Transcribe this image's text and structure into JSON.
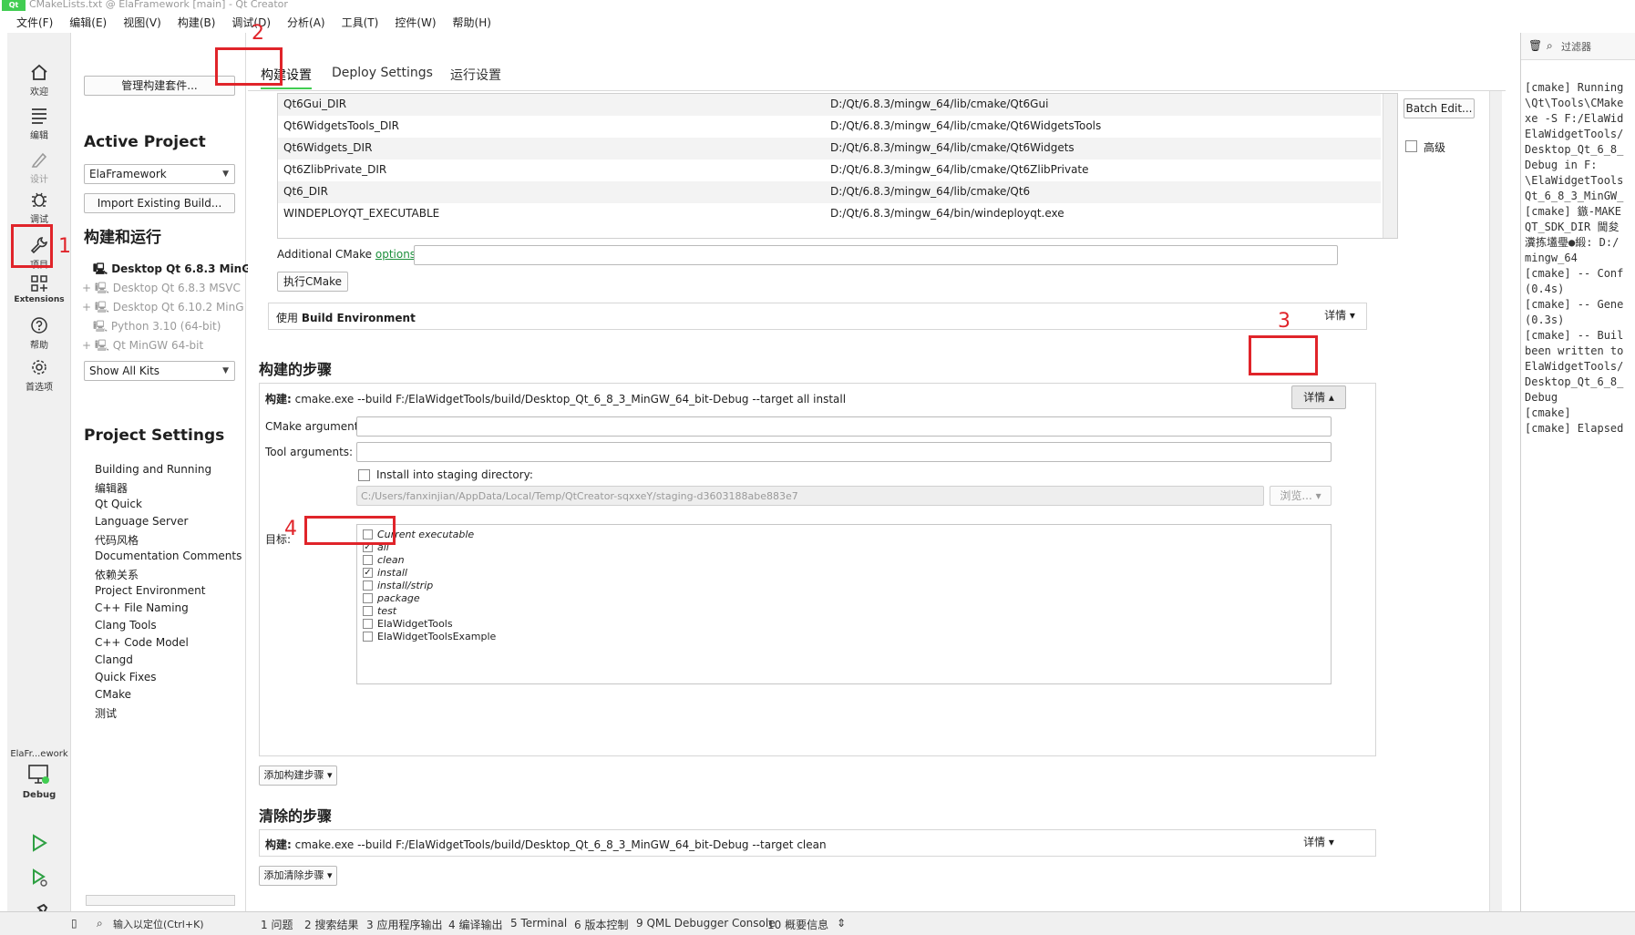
{
  "window": {
    "app_badge": "Qt",
    "title": "CMakeLists.txt @ ElaFramework [main] - Qt Creator"
  },
  "menu": [
    "文件(F)",
    "编辑(E)",
    "视图(V)",
    "构建(B)",
    "调试(D)",
    "分析(A)",
    "工具(T)",
    "控件(W)",
    "帮助(H)"
  ],
  "modebar": {
    "welcome": "欢迎",
    "edit": "编辑",
    "design": "设计",
    "debug": "调试",
    "projects": "项目",
    "extensions": "Extensions",
    "help": "帮助",
    "preferences": "首选项",
    "target_project": "ElaFr...ework",
    "target_config": "Debug"
  },
  "left": {
    "manage_kits": "管理构建套件...",
    "active_project_title": "Active Project",
    "active_project": "ElaFramework",
    "import_build": "Import Existing Build...",
    "build_run_title": "构建和运行",
    "kits": [
      "Desktop Qt 6.8.3 MinG",
      "Desktop Qt 6.8.3 MSVC",
      "Desktop Qt 6.10.2 MinG",
      "Python 3.10 (64-bit)",
      "Qt  MinGW 64-bit"
    ],
    "show_kits": "Show All Kits",
    "project_settings_title": "Project Settings",
    "settings": [
      "Building and Running",
      "编辑器",
      "Qt Quick",
      "Language Server",
      "代码风格",
      "Documentation Comments",
      "依赖关系",
      "Project Environment",
      "C++ File Naming",
      "Clang Tools",
      "C++ Code Model",
      "Clangd",
      "Quick Fixes",
      "CMake",
      "测试"
    ]
  },
  "tabs": [
    "构建设置",
    "Deploy Settings",
    "运行设置"
  ],
  "cmake_table": [
    {
      "key": "Qt6Gui_DIR",
      "value": "D:/Qt/6.8.3/mingw_64/lib/cmake/Qt6Gui"
    },
    {
      "key": "Qt6WidgetsTools_DIR",
      "value": "D:/Qt/6.8.3/mingw_64/lib/cmake/Qt6WidgetsTools"
    },
    {
      "key": "Qt6Widgets_DIR",
      "value": "D:/Qt/6.8.3/mingw_64/lib/cmake/Qt6Widgets"
    },
    {
      "key": "Qt6ZlibPrivate_DIR",
      "value": "D:/Qt/6.8.3/mingw_64/lib/cmake/Qt6ZlibPrivate"
    },
    {
      "key": "Qt6_DIR",
      "value": "D:/Qt/6.8.3/mingw_64/lib/cmake/Qt6"
    },
    {
      "key": "WINDEPLOYQT_EXECUTABLE",
      "value": "D:/Qt/6.8.3/mingw_64/bin/windeployqt.exe"
    }
  ],
  "batch_edit": "Batch Edit...",
  "advanced": "高级",
  "additional_cmake_label": "Additional CMake ",
  "additional_cmake_link": "options",
  "additional_cmake_colon": ":",
  "run_cmake": "执行CMake",
  "build_env_prefix": "使用",
  "build_env": "Build Environment",
  "details": "详情",
  "build_steps_title": "构建的步骤",
  "build_step_prefix": "构建:",
  "build_step_cmd": "cmake.exe --build F:/ElaWidgetTools/build/Desktop_Qt_6_8_3_MinGW_64_bit-Debug --target all install",
  "cmake_args_label": "CMake arguments:",
  "tool_args_label": "Tool arguments:",
  "staging_label": "Install into staging directory:",
  "staging_path": "C:/Users/fanxinjian/AppData/Local/Temp/QtCreator-sqxxeY/staging-d3603188abe883e7",
  "browse": "浏览...",
  "targets_label": "目标:",
  "targets": [
    {
      "name": "Current executable",
      "checked": false,
      "italic": true
    },
    {
      "name": "all",
      "checked": true,
      "italic": true
    },
    {
      "name": "clean",
      "checked": false,
      "italic": true
    },
    {
      "name": "install",
      "checked": true,
      "italic": true
    },
    {
      "name": "install/strip",
      "checked": false,
      "italic": true
    },
    {
      "name": "package",
      "checked": false,
      "italic": true
    },
    {
      "name": "test",
      "checked": false,
      "italic": true
    },
    {
      "name": "ElaWidgetTools",
      "checked": false,
      "italic": false
    },
    {
      "name": "ElaWidgetToolsExample",
      "checked": false,
      "italic": false
    }
  ],
  "add_build_step": "添加构建步骤",
  "clean_steps_title": "清除的步骤",
  "clean_step_cmd": "cmake.exe --build F:/ElaWidgetTools/build/Desktop_Qt_6_8_3_MinGW_64_bit-Debug --target clean",
  "add_clean_step": "添加清除步骤",
  "annotations": [
    "1",
    "2",
    "3",
    "4"
  ],
  "right": {
    "filter": "过滤器",
    "log": "[cmake] Running\n\\Qt\\Tools\\CMake\nxe -S F:/ElaWid\nElaWidgetTools/\nDesktop_Qt_6_8_\nDebug in F:\n\\ElaWidgetTools\nQt_6_8_3_MinGW_\n[cmake] 鏃-MAKE\nQT_SDK_DIR 閫夋\n瀵拣壒璺●緞: D:/\nmingw_64\n[cmake] -- Conf\n(0.4s)\n[cmake] -- Gene\n(0.3s)\n[cmake] -- Buil\nbeen written to\nElaWidgetTools/\nDesktop_Qt_6_8_\nDebug\n[cmake]\n[cmake] Elapsed"
  },
  "statusbar": {
    "locator": "输入以定位(Ctrl+K)",
    "panes": [
      "1  问题",
      "2  搜索结果",
      "3  应用程序输出",
      "4  编译输出",
      "5  Terminal",
      "6  版本控制",
      "9  QML Debugger Console",
      "10  概要信息"
    ]
  },
  "colors": {
    "accent_red": "#e0242a",
    "qt_green": "#41cd52",
    "link_green": "#1c8f3b"
  }
}
